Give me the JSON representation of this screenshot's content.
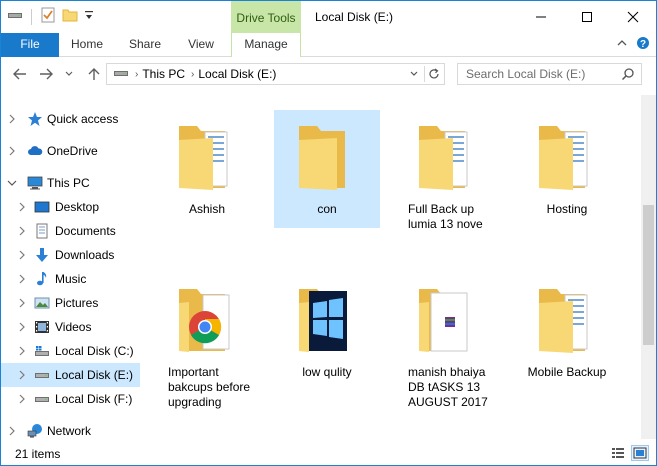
{
  "window": {
    "title": "Local Disk (E:)",
    "context_tab": "Drive Tools"
  },
  "ribbon": {
    "tabs": [
      {
        "label": "File"
      },
      {
        "label": "Home"
      },
      {
        "label": "Share"
      },
      {
        "label": "View"
      },
      {
        "label": "Manage"
      }
    ]
  },
  "address": {
    "crumbs": [
      "This PC",
      "Local Disk (E:)"
    ]
  },
  "search": {
    "placeholder": "Search Local Disk (E:)"
  },
  "sidebar": {
    "items": [
      {
        "label": "Quick access",
        "icon": "star-icon"
      },
      {
        "label": "OneDrive",
        "icon": "cloud-icon"
      },
      {
        "label": "This PC",
        "icon": "computer-icon"
      },
      {
        "label": "Desktop",
        "icon": "desktop-icon"
      },
      {
        "label": "Documents",
        "icon": "documents-icon"
      },
      {
        "label": "Downloads",
        "icon": "download-icon"
      },
      {
        "label": "Music",
        "icon": "music-icon"
      },
      {
        "label": "Pictures",
        "icon": "pictures-icon"
      },
      {
        "label": "Videos",
        "icon": "videos-icon"
      },
      {
        "label": "Local Disk (C:)",
        "icon": "drive-icon"
      },
      {
        "label": "Local Disk (E:)",
        "icon": "drive-icon",
        "selected": true
      },
      {
        "label": "Local Disk (F:)",
        "icon": "drive-icon"
      },
      {
        "label": "Network",
        "icon": "network-icon"
      }
    ]
  },
  "files": [
    {
      "name": "Ashish",
      "type": "folder-with-docs"
    },
    {
      "name": "con",
      "type": "folder-empty",
      "selected": true
    },
    {
      "name": "Full Back up lumia 13 nove",
      "type": "folder-with-docs"
    },
    {
      "name": "Hosting",
      "type": "folder-with-docs"
    },
    {
      "name": "Important bakcups before upgrading",
      "type": "folder-chrome"
    },
    {
      "name": "low qulity",
      "type": "folder-windows"
    },
    {
      "name": "manish bhaiya DB tASKS 13 AUGUST 2017",
      "type": "folder-winrar"
    },
    {
      "name": "Mobile Backup",
      "type": "folder-with-docs"
    }
  ],
  "status": {
    "item_count": "21 items"
  },
  "colors": {
    "accent": "#1979ca",
    "selection": "#cce8ff",
    "context_tab": "#c8e6a8",
    "folder": "#f8d775"
  }
}
